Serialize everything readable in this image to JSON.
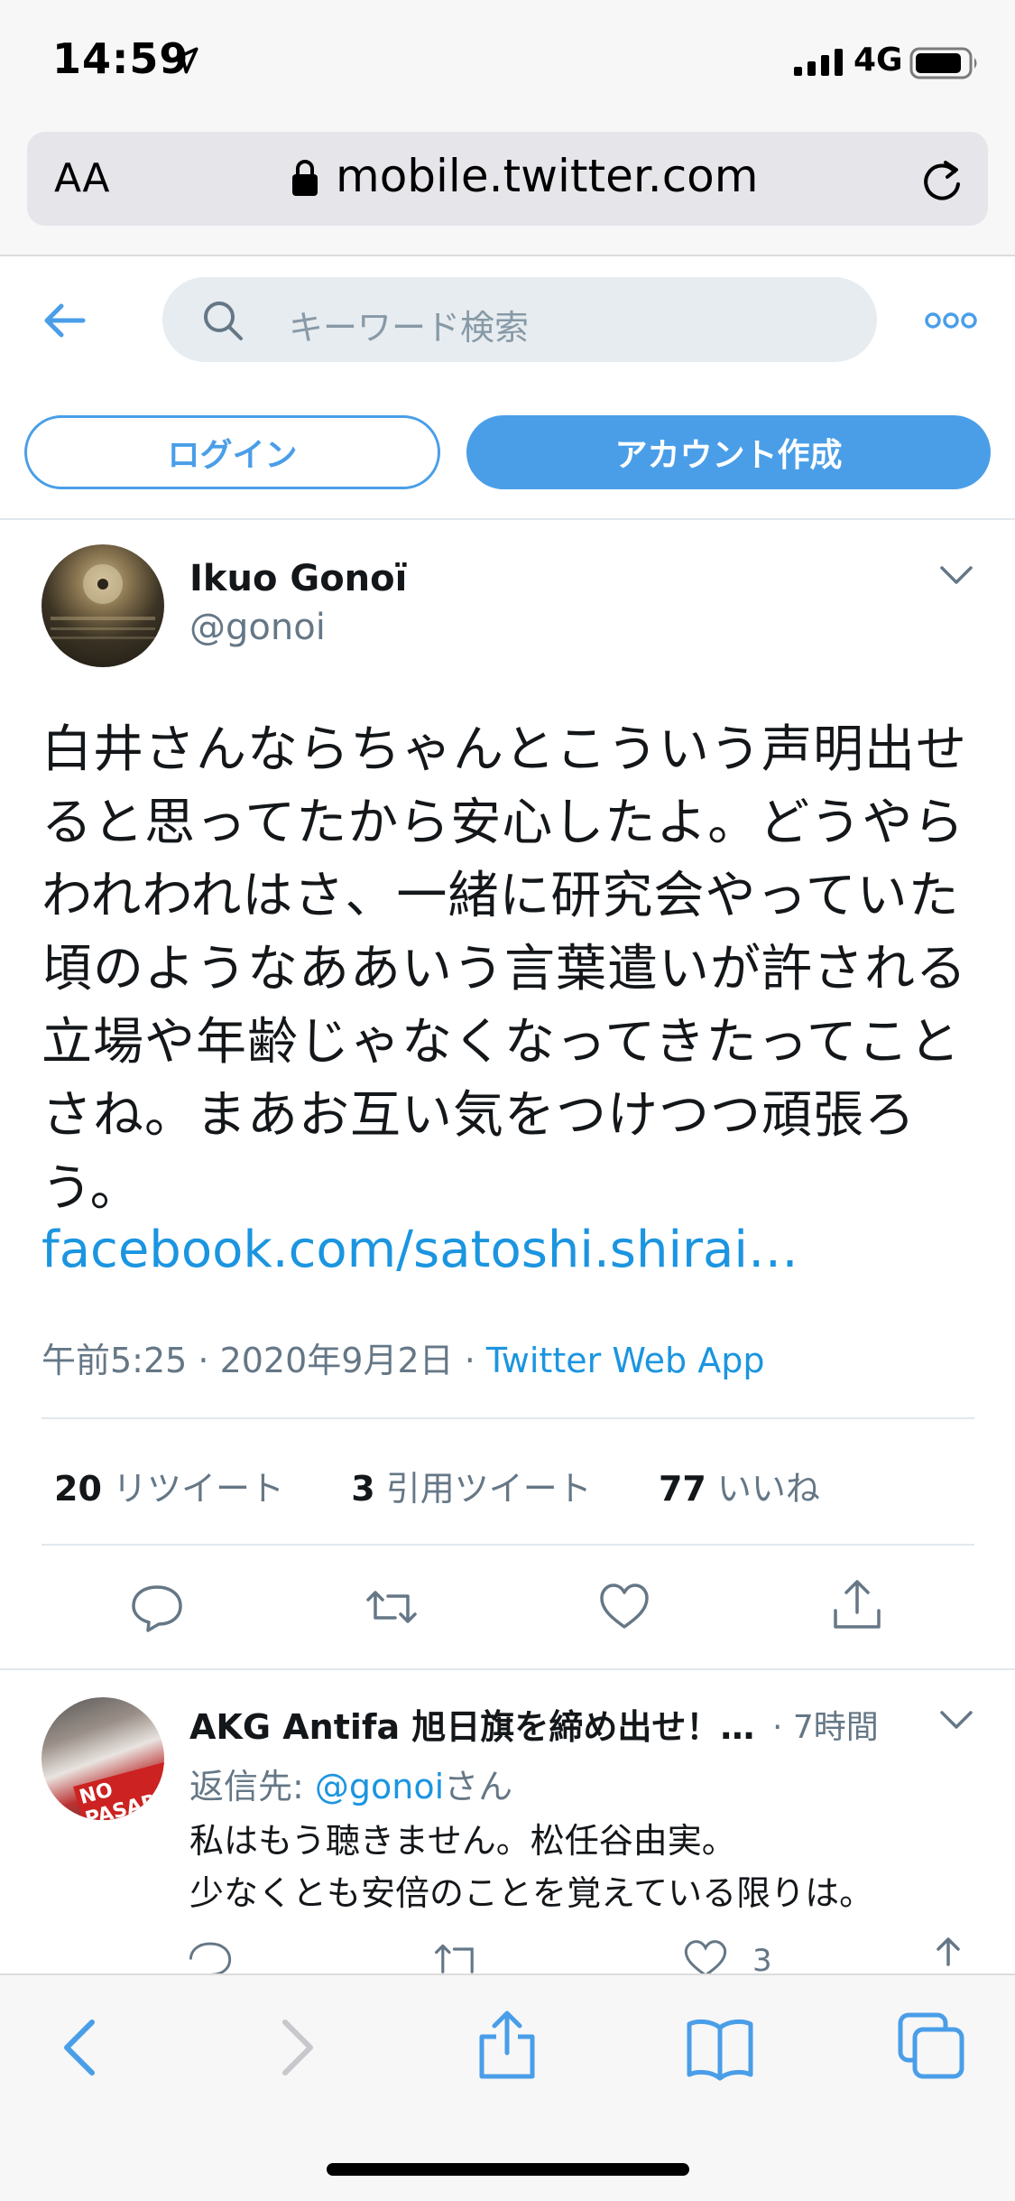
{
  "status_bar": {
    "time": "14:59",
    "network": "4G"
  },
  "browser": {
    "text_size_label": "AA",
    "url": "mobile.twitter.com"
  },
  "header": {
    "search_placeholder": "キーワード検索",
    "login_label": "ログイン",
    "signup_label": "アカウント作成"
  },
  "tweet": {
    "name": "Ikuo Gonoï",
    "handle": "@gonoi",
    "text": "白井さんならちゃんとこういう声明出せると思ってたから安心したよ。どうやらわれわれはさ、一緒に研究会やっていた頃のようなああいう言葉遣いが許される立場や年齢じゃなくなってきたってことさね。まあお互い気をつけつつ頑張ろう。",
    "link": "facebook.com/satoshi.shirai…",
    "timestamp": "午前5:25 · 2020年9月2日 · ",
    "source": "Twitter Web App",
    "retweets": "20",
    "retweets_label": "リツイート",
    "quotes": "3",
    "quotes_label": "引用ツイート",
    "likes": "77",
    "likes_label": "いいね"
  },
  "reply": {
    "name": "AKG Antifa 旭日旗を締め出せ！…",
    "time": " · 7時間",
    "replying_to_prefix": "返信先: ",
    "replying_to_handle": "@gonoi",
    "replying_to_suffix": "さん",
    "line1": "私はもう聴きません。松任谷由実。",
    "line2": "少なくとも安倍のことを覚えている限りは。",
    "like_count": "3",
    "avatar_text": "NO PASARAN"
  },
  "colors": {
    "twitter_blue": "#4a9ee8",
    "link_blue": "#1b95e0",
    "gray_text": "#657786"
  }
}
